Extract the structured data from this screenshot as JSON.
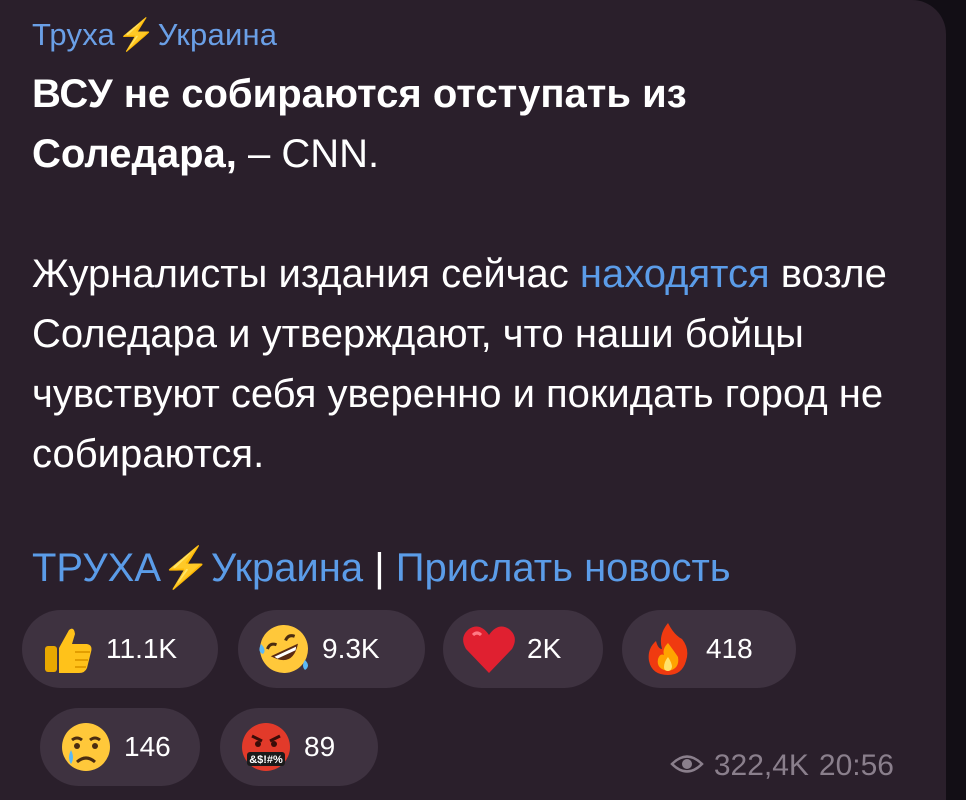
{
  "message": {
    "channel_name_part1": "Труха",
    "channel_name_part2": "Украина",
    "headline_bold": "ВСУ не собираются отступать из Соледара,",
    "headline_source": " – CNN.",
    "body_part1": "Журналисты издания сейчас ",
    "body_link": "находятся",
    "body_part2": " возле Соледара и утверждают, что наши бойцы чувствуют себя уверенно и покидать город не собираются.",
    "footer_link1_part1": "ТРУХА",
    "footer_link1_part2": "Украина",
    "footer_separator": " | ",
    "footer_link2": "Прислать новость",
    "views": "322,4K",
    "time": "20:56"
  },
  "reactions": [
    {
      "icon": "thumbs-up-icon",
      "count": "11.1K"
    },
    {
      "icon": "rofl-icon",
      "count": "9.3K"
    },
    {
      "icon": "heart-icon",
      "count": "2K"
    },
    {
      "icon": "fire-icon",
      "count": "418"
    },
    {
      "icon": "crying-face-icon",
      "count": "146"
    },
    {
      "icon": "cursing-face-icon",
      "count": "89"
    }
  ],
  "colors": {
    "bubble": "#2a1f2b",
    "link": "#5b9ce8",
    "reaction_bg": "#3e3240",
    "meta_text": "#8a7f8c"
  }
}
